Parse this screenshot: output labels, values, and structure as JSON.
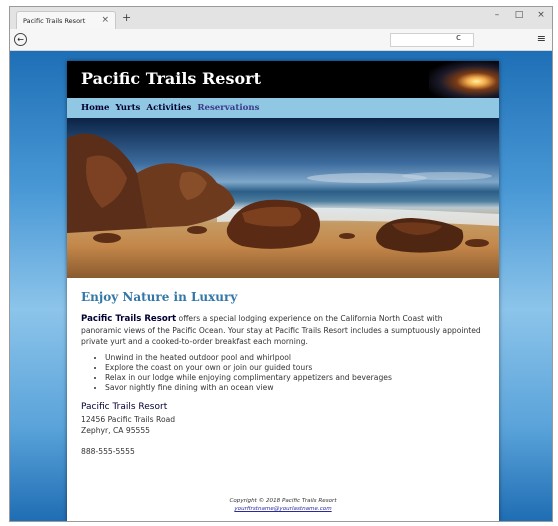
{
  "browser": {
    "tab_title": "Pacific Trails Resort",
    "tab_close": "×",
    "new_tab": "+",
    "minimize": "–",
    "maximize": "□",
    "close": "×",
    "back": "←",
    "reload": "c",
    "menu": "≡"
  },
  "header": {
    "title": "Pacific Trails Resort"
  },
  "nav": {
    "items": [
      "Home",
      "Yurts",
      "Activities",
      "Reservations"
    ]
  },
  "main": {
    "heading": "Enjoy Nature in Luxury",
    "intro_brand": "Pacific Trails Resort",
    "intro_text": " offers a special lodging experience on the California North Coast with panoramic views of the Pacific Ocean. Your stay at Pacific Trails Resort includes a sumptuously appointed private yurt and a cooked-to-order breakfast each morning.",
    "features": [
      "Unwind in the heated outdoor pool and whirlpool",
      "Explore the coast on your own or join our guided tours",
      "Relax in our lodge while enjoying complimentary appetizers and beverages",
      "Savor nightly fine dining with an ocean view"
    ],
    "contact_name": "Pacific Trails Resort",
    "address_line1": "12456 Pacific Trails Road",
    "address_line2": "Zephyr, CA 95555",
    "phone": "888-555-5555"
  },
  "footer": {
    "copyright": "Copyright © 2018 Pacific Trails Resort",
    "email": "yourfirstname@yourlastname.com"
  }
}
